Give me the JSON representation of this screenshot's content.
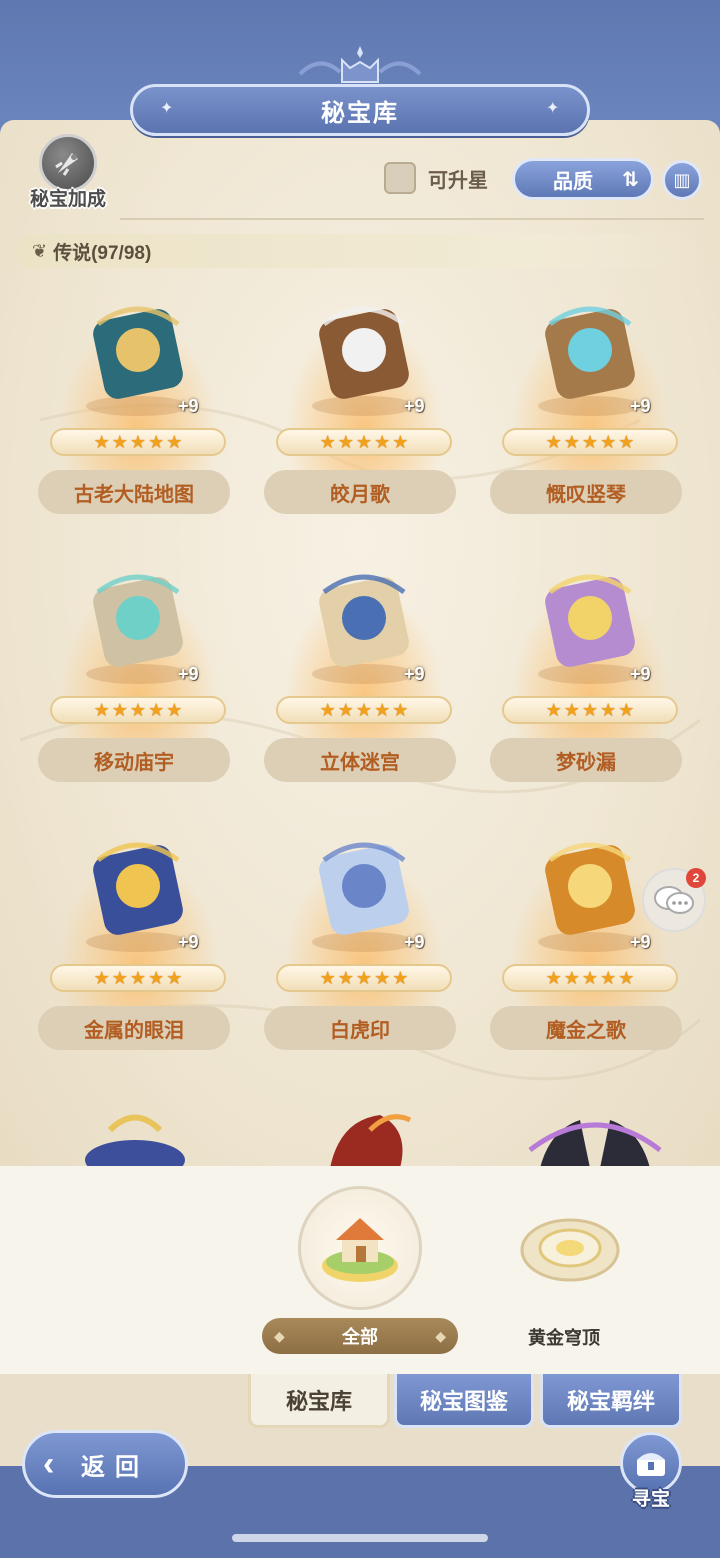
{
  "header": {
    "title": "秘宝库"
  },
  "toolbar": {
    "bonus_label": "秘宝加成",
    "upgradable_label": "可升星",
    "sort_label": "品质"
  },
  "section": {
    "title": "传说(97/98)"
  },
  "cards": [
    {
      "name": "古老大陆地图",
      "level": "+9",
      "stars": 5,
      "icon": "ancient-map-book-icon"
    },
    {
      "name": "皎月歌",
      "level": "+9",
      "stars": 5,
      "icon": "horn-icon"
    },
    {
      "name": "慨叹竖琴",
      "level": "+9",
      "stars": 5,
      "icon": "harp-icon"
    },
    {
      "name": "移动庙宇",
      "level": "+9",
      "stars": 5,
      "icon": "temple-icon"
    },
    {
      "name": "立体迷宫",
      "level": "+9",
      "stars": 5,
      "icon": "maze-icon"
    },
    {
      "name": "梦砂漏",
      "level": "+9",
      "stars": 5,
      "icon": "hourglass-icon"
    },
    {
      "name": "金属的眼泪",
      "level": "+9",
      "stars": 5,
      "icon": "metal-tear-shield-icon"
    },
    {
      "name": "白虎印",
      "level": "+9",
      "stars": 5,
      "icon": "white-tiger-seal-icon"
    },
    {
      "name": "魔金之歌",
      "level": "+9",
      "stars": 5,
      "icon": "magic-gold-song-icon"
    }
  ],
  "categories": [
    {
      "label": "全部",
      "selected": true,
      "icon": "island-house-icon"
    },
    {
      "label": "黄金穹顶",
      "selected": false,
      "icon": "golden-dome-icon"
    }
  ],
  "tabs": [
    {
      "label": "秘宝库",
      "active": true
    },
    {
      "label": "秘宝图鉴",
      "active": false
    },
    {
      "label": "秘宝羁绊",
      "active": false
    }
  ],
  "footer": {
    "back_label": "返回",
    "treasure_hunt_label": "寻宝"
  },
  "chat": {
    "badge_count": "2"
  },
  "colors": {
    "frame_blue": "#5e76ad",
    "parchment": "#f4ecdb",
    "item_name": "#b25d22",
    "star_gold": "#f0a21e",
    "badge_red": "#e0473a"
  }
}
